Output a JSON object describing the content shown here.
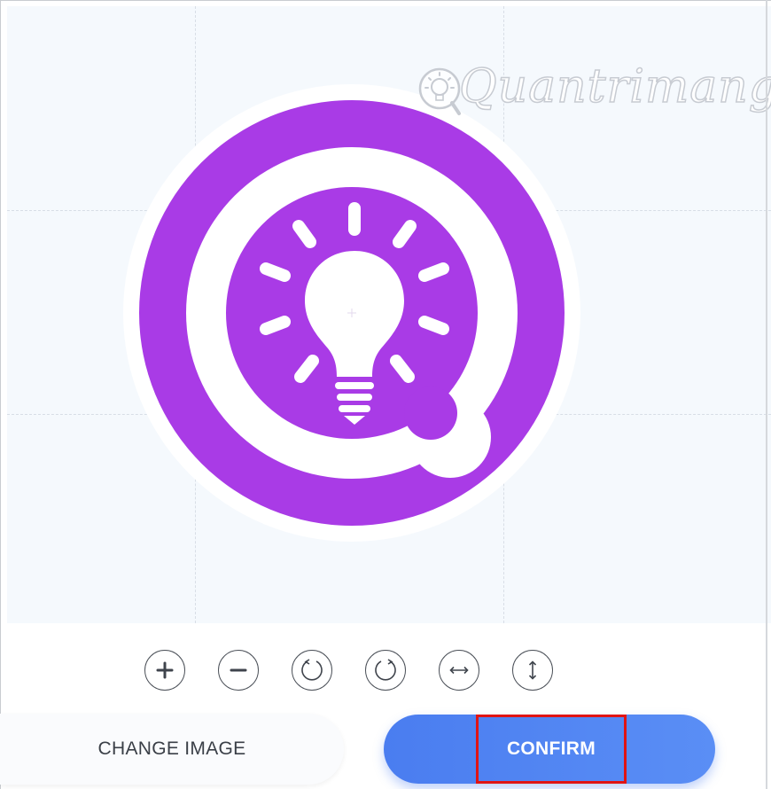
{
  "watermark": {
    "text": "Quantrimang",
    "icon": "lightbulb-icon"
  },
  "logo": {
    "icon": "lightbulb-q-logo",
    "colors": {
      "purple": "#a93be6",
      "ring": "#ffffff"
    }
  },
  "toolbar": {
    "zoom_in": "zoom-in",
    "zoom_out": "zoom-out",
    "rotate_left": "rotate-left",
    "rotate_right": "rotate-right",
    "flip_horizontal": "flip-horizontal",
    "flip_vertical": "flip-vertical"
  },
  "actions": {
    "change_image_label": "CHANGE IMAGE",
    "confirm_label": "CONFIRM"
  },
  "colors": {
    "accent": "#4a7df0",
    "highlight_border": "#e01414",
    "canvas_bg": "#f5f9fd"
  }
}
